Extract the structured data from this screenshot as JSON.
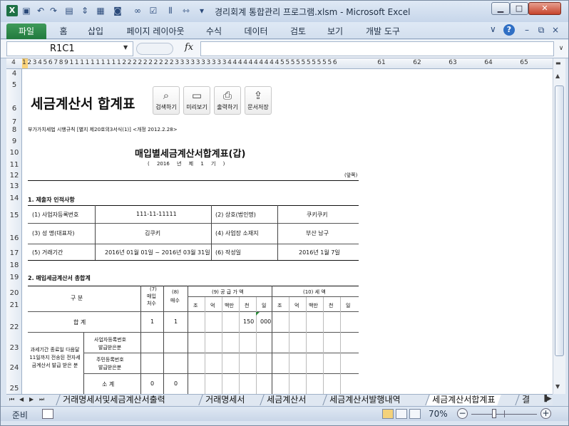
{
  "window": {
    "title": "경리회계 통합관리 프로그램.xlsm  -  Microsoft Excel",
    "minimize_glyph": "▁",
    "maximize_glyph": "□",
    "close_glyph": "✕"
  },
  "quick_access": [
    "save-icon",
    "undo-icon",
    "redo-icon",
    "form-icon",
    "sort-icon",
    "table-icon",
    "camera-icon",
    "link-icon",
    "checklist-icon",
    "align-icon",
    "spacing-icon",
    "customize-icon"
  ],
  "ribbon": {
    "tabs": [
      "파일",
      "홈",
      "삽입",
      "페이지 레이아웃",
      "수식",
      "데이터",
      "검토",
      "보기",
      "개발 도구"
    ],
    "help_glyph": "?"
  },
  "formula_bar": {
    "name_box": "R1C1",
    "fx_label": "fx",
    "formula": ""
  },
  "columns": {
    "narrow_run": "1 2 3 4 5 6 7 8 9 1 1 1 1 1 1 1 1 1 1 2 2 2 2 2 2 2 2 2 2 3 3 3 3 3 3 3 3 3 3 4 4 4 4 4 4 4 4 4 4 5 5 5 5 5 5 5 5 5 5 6",
    "first": "4",
    "wide": [
      "61",
      "62",
      "63",
      "64",
      "65"
    ]
  },
  "rows": [
    "4",
    "5",
    "6",
    "7",
    "8",
    "9",
    "10",
    "11",
    "12",
    "13",
    "14",
    "15",
    "16",
    "17",
    "18",
    "19",
    "20",
    "21",
    "22",
    "23",
    "24",
    "25"
  ],
  "sheet": {
    "doc_title": "세금계산서 합계표",
    "toolbar": [
      {
        "label": "검색하기",
        "icon": "search-icon"
      },
      {
        "label": "미리보기",
        "icon": "monitor-icon"
      },
      {
        "label": "출력하기",
        "icon": "printer-icon"
      },
      {
        "label": "문서저장",
        "icon": "export-icon"
      }
    ],
    "legal_ref": "부가가치세법 시행규칙 [별지 제20호의3서식(1)] <개정 2012.2.28>",
    "form_title": "매입별세금계산서합계표(갑)",
    "form_period": "( 2016 년 제 1 기 )",
    "form_side": "(앞쪽)",
    "section1": "1. 제출자 인적사항",
    "info": {
      "biz_no_label": "(1) 사업자등록번호",
      "biz_no_value": "111-11-11111",
      "trade_name_label": "(2) 상호(법인명)",
      "trade_name_value": "쿠키쿠키",
      "rep_label": "(3) 성 명(대표자)",
      "rep_value": "김쿠키",
      "addr_label": "(4) 사업장 소재지",
      "addr_value": "부산 남구",
      "period_label": "(5) 거래기간",
      "period_value": "2016년 01월 01일 ~ 2016년 03월 31일",
      "date_label": "(6) 작성일",
      "date_value": "2016년 1월 7일"
    },
    "section2": "2. 매입세금계산서 총합계",
    "table": {
      "h_category": "구    분",
      "h_suppliers_no": "(7)",
      "h_suppliers_1": "매입",
      "h_suppliers_2": "처수",
      "h_sheets_no": "(8)",
      "h_sheets": "매수",
      "h_supply": "(9) 공 급 가 액",
      "h_tax": "(10) 세  액",
      "digits_supply": [
        "조",
        "억",
        "백만",
        "천",
        "일"
      ],
      "digits_tax": [
        "조",
        "억",
        "백만",
        "천",
        "일"
      ],
      "total_label": "합    계",
      "total_suppliers": "1",
      "total_sheets": "1",
      "total_supply_thousand": "150",
      "total_supply_unit": "000",
      "group_label": "과세기간 종료일 다음달 11일까지 전송된 전자세금계산서 발급 받은 분",
      "sub_biz_1": "사업자등록번호",
      "sub_biz_2": "발급받은분",
      "sub_res_1": "주민등록번호",
      "sub_res_2": "발급받은분",
      "subtotal_label": "소  계",
      "subtotal_suppliers": "0",
      "subtotal_sheets": "0"
    }
  },
  "sheet_tabs": {
    "nav": [
      "⏮",
      "◀",
      "▶",
      "⏭"
    ],
    "tabs": [
      "거래명세서및세금계산서출력",
      "거래명세서",
      "세금계산서",
      "세금계산서발행내역",
      "세금계산서합계표",
      "결"
    ],
    "active": "세금계산서합계표"
  },
  "status_bar": {
    "ready": "준비",
    "zoom": "70%",
    "zoom_out": "−",
    "zoom_in": "+",
    "zoom_fraction": 0.35
  }
}
